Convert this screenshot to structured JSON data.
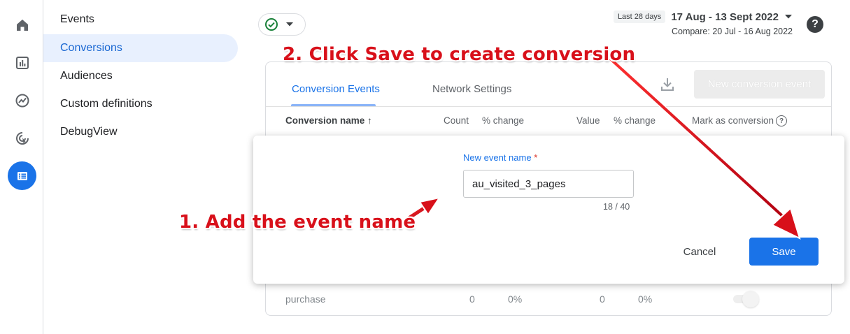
{
  "sidebar": {
    "items": [
      {
        "label": "Events"
      },
      {
        "label": "Conversions"
      },
      {
        "label": "Audiences"
      },
      {
        "label": "Custom definitions"
      },
      {
        "label": "DebugView"
      }
    ]
  },
  "header": {
    "date_chip": "Last 28 days",
    "date_range": "17 Aug - 13 Sept 2022",
    "compare": "Compare: 20 Jul - 16 Aug 2022",
    "help_glyph": "?"
  },
  "card": {
    "tabs": [
      {
        "label": "Conversion Events"
      },
      {
        "label": "Network Settings"
      }
    ],
    "new_conversion_label": "New conversion event",
    "columns": [
      {
        "label": "Conversion name ↑"
      },
      {
        "label": "Count"
      },
      {
        "label": "% change"
      },
      {
        "label": "Value"
      },
      {
        "label": "% change"
      },
      {
        "label": "Mark as conversion"
      }
    ],
    "row": {
      "name": "purchase",
      "count": "0",
      "count_change": "0%",
      "value": "0",
      "value_change": "0%"
    }
  },
  "dialog": {
    "field_label": "New event name",
    "required_mark": "*",
    "value": "au_visited_3_pages",
    "counter": "18 / 40",
    "cancel_label": "Cancel",
    "save_label": "Save"
  },
  "annotations": {
    "step1": "1. Add the event name",
    "step2": "2. Click Save to create conversion"
  },
  "colors": {
    "accent": "#1a73e8",
    "annotation": "#d8101a",
    "success": "#188038"
  }
}
